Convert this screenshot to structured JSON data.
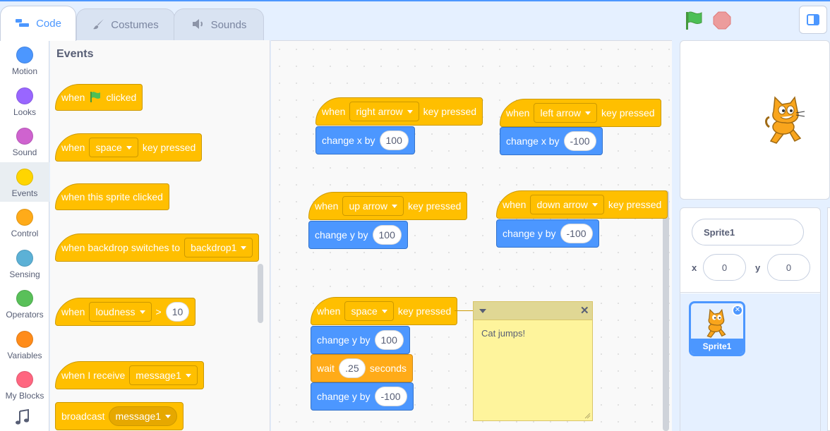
{
  "tabs": {
    "code": "Code",
    "costumes": "Costumes",
    "sounds": "Sounds"
  },
  "categories": [
    {
      "label": "Motion",
      "color": "#4c97ff"
    },
    {
      "label": "Looks",
      "color": "#9966ff"
    },
    {
      "label": "Sound",
      "color": "#cf63cf"
    },
    {
      "label": "Events",
      "color": "#ffd500"
    },
    {
      "label": "Control",
      "color": "#ffab19"
    },
    {
      "label": "Sensing",
      "color": "#5cb1d6"
    },
    {
      "label": "Operators",
      "color": "#59c059"
    },
    {
      "label": "Variables",
      "color": "#ff8c1a"
    },
    {
      "label": "My Blocks",
      "color": "#ff6680"
    }
  ],
  "palette": {
    "title": "Events",
    "flag_when": "when",
    "flag_clicked": "clicked",
    "key_when": "when",
    "key_value": "space",
    "key_pressed": "key pressed",
    "sprite_clicked": "when this sprite clicked",
    "backdrop_text": "when backdrop switches to",
    "backdrop_value": "backdrop1",
    "loud_when": "when",
    "loud_value": "loudness",
    "loud_op": ">",
    "loud_num": "10",
    "receive_text": "when I receive",
    "receive_value": "message1",
    "broadcast_text": "broadcast",
    "broadcast_value": "message1"
  },
  "scripts": {
    "s1": {
      "when": "when",
      "key": "right arrow",
      "pressed": "key pressed",
      "cmd": "change x by",
      "val": "100"
    },
    "s2": {
      "when": "when",
      "key": "left arrow",
      "pressed": "key pressed",
      "cmd": "change x by",
      "val": "-100"
    },
    "s3": {
      "when": "when",
      "key": "up arrow",
      "pressed": "key pressed",
      "cmd": "change y by",
      "val": "100"
    },
    "s4": {
      "when": "when",
      "key": "down arrow",
      "pressed": "key pressed",
      "cmd": "change y by",
      "val": "-100"
    },
    "s5": {
      "when": "when",
      "key": "space",
      "pressed": "key pressed",
      "cmd1": "change y by",
      "val1": "100",
      "wait": "wait",
      "wait_val": ".25",
      "seconds": "seconds",
      "cmd2": "change y by",
      "val2": "-100"
    }
  },
  "note": {
    "text": "Cat jumps!"
  },
  "sprite": {
    "name": "Sprite1",
    "x_label": "x",
    "x": "0",
    "y_label": "y",
    "y": "0",
    "thumb_label": "Sprite1"
  },
  "colors": {
    "events": "#ffbf00",
    "motion": "#4c97ff",
    "control": "#ffab19",
    "accent": "#4c97ff"
  }
}
